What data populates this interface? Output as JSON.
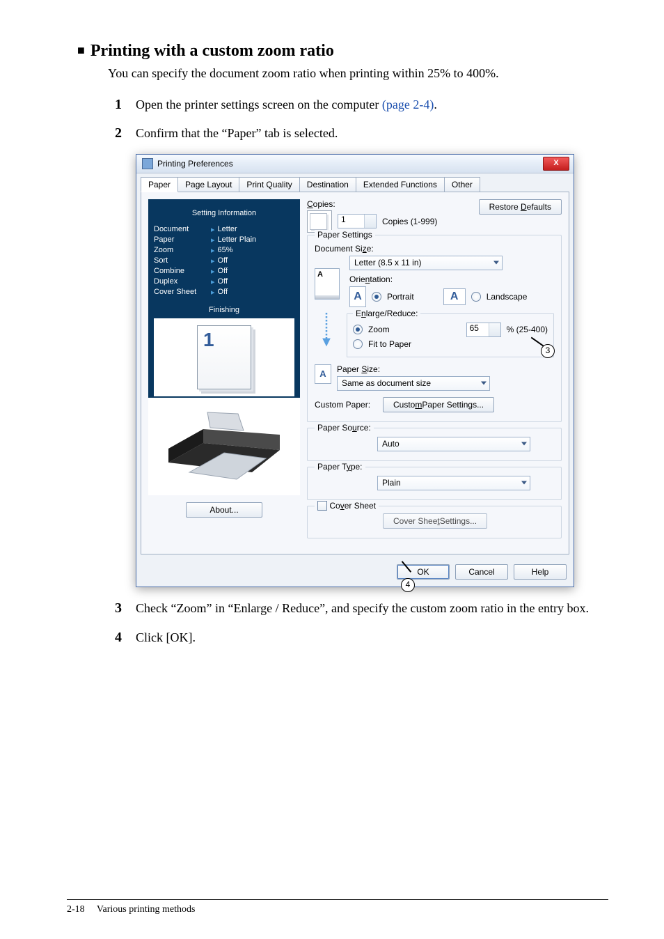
{
  "heading": "Printing with a custom zoom ratio",
  "intro": "You can specify the document zoom ratio when printing within 25% to 400%.",
  "steps": {
    "n1": "1",
    "t1_a": "Open the printer settings screen on the computer ",
    "t1_link": "(page 2-4)",
    "t1_b": ".",
    "n2": "2",
    "t2": "Confirm that the “Paper” tab is selected.",
    "n3": "3",
    "t3": "Check “Zoom” in “Enlarge / Reduce”, and specify the custom zoom ratio in the entry box.",
    "n4": "4",
    "t4": "Click [OK]."
  },
  "dialog": {
    "title": "Printing Preferences",
    "close": "X",
    "tabs": {
      "paper": "Paper",
      "page_layout": "Page Layout",
      "print_quality": "Print Quality",
      "destination": "Destination",
      "ext_functions": "Extended Functions",
      "other": "Other"
    },
    "setting_info": {
      "title": "Setting Information",
      "rows": [
        {
          "k": "Document",
          "v": "Letter"
        },
        {
          "k": "Paper",
          "v": "Letter Plain"
        },
        {
          "k": "Zoom",
          "v": "65%"
        },
        {
          "k": "Sort",
          "v": "Off"
        },
        {
          "k": "Combine",
          "v": "Off"
        },
        {
          "k": "Duplex",
          "v": "Off"
        },
        {
          "k": "Cover Sheet",
          "v": "Off"
        }
      ],
      "finishing": "Finishing",
      "one": "1"
    },
    "about": "About...",
    "copies_lbl": "Copies:",
    "copies_val": "1",
    "copies_range": "Copies (1-999)",
    "restore_defaults": "Restore Defaults",
    "paper_settings": "Paper Settings",
    "doc_size_lbl": "Document Size:",
    "doc_size_val": "Letter (8.5 x 11 in)",
    "orientation_lbl": "Orientation:",
    "portrait": "Portrait",
    "landscape": "Landscape",
    "enlarge_reduce": "Enlarge/Reduce:",
    "zoom": "Zoom",
    "zoom_val": "65",
    "zoom_range": "% (25-400)",
    "fit_to_paper": "Fit to Paper",
    "paper_size_lbl": "Paper Size:",
    "paper_size_val": "Same as document size",
    "custom_paper": "Custom Paper:",
    "custom_paper_btn": "Custom Paper Settings...",
    "paper_source": "Paper Source:",
    "paper_source_val": "Auto",
    "paper_type": "Paper Type:",
    "paper_type_val": "Plain",
    "cover_sheet_chk": "Cover Sheet",
    "cover_sheet_btn": "Cover Sheet Settings...",
    "ok": "OK",
    "cancel": "Cancel",
    "help": "Help"
  },
  "callouts": {
    "c3": "3",
    "c4": "4"
  },
  "footer": {
    "page": "2-18",
    "title": "Various printing methods"
  }
}
